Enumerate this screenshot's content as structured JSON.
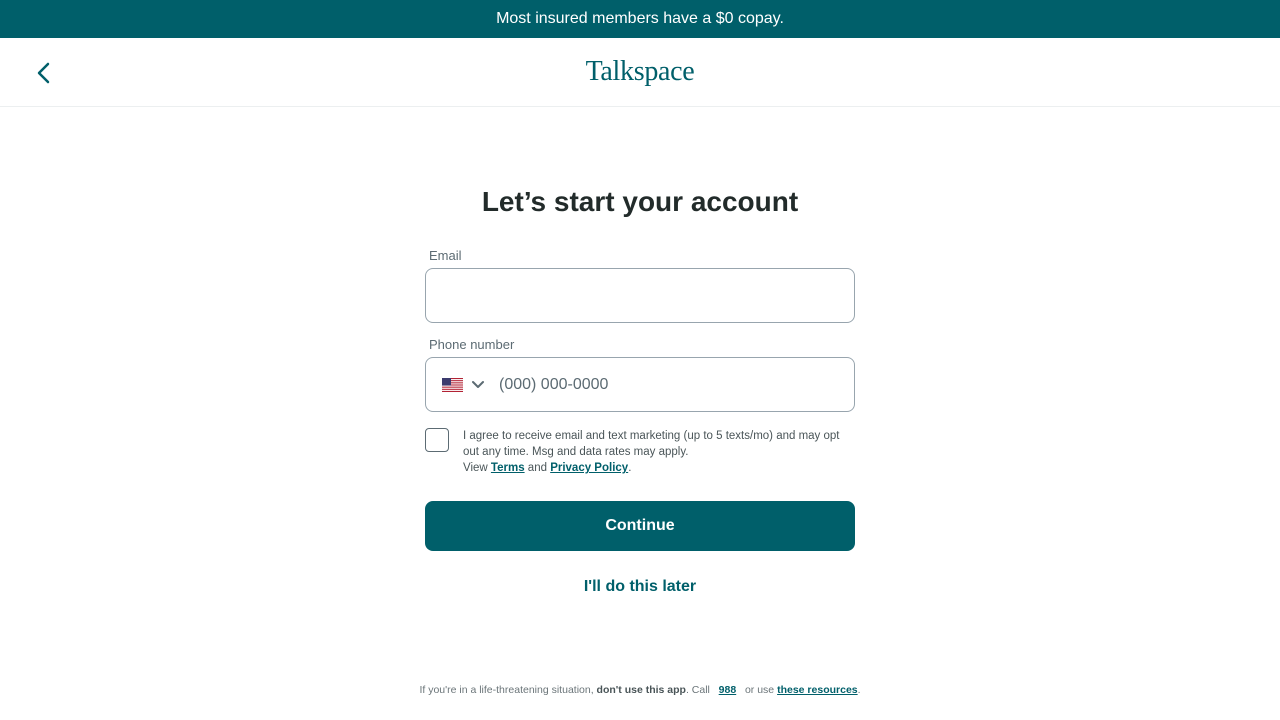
{
  "banner": {
    "text": "Most insured members have a $0 copay."
  },
  "header": {
    "logo_text": "Talkspace",
    "back_icon": "chevron-left-icon"
  },
  "form": {
    "title": "Let’s start your account",
    "email": {
      "label": "Email",
      "value": "",
      "placeholder": ""
    },
    "phone": {
      "label": "Phone number",
      "placeholder": "(000) 000-0000",
      "country_icon": "us-flag-icon",
      "dropdown_icon": "chevron-down-icon"
    },
    "consent": {
      "checked": false,
      "text": "I agree to receive email and text marketing (up to 5 texts/mo) and may opt out any time. Msg and data rates may apply.",
      "view_prefix": "View",
      "terms_link": "Terms",
      "and_text": "and",
      "privacy_link": "Privacy Policy",
      "period": "."
    },
    "continue_label": "Continue",
    "later_label": "I'll do this later"
  },
  "footer": {
    "prefix": "If you're in a life-threatening situation, ",
    "strong": "don't use this app",
    "call_text": ". Call",
    "number_link": "988",
    "or_text": "or use",
    "resources_link": "these resources",
    "period": "."
  },
  "colors": {
    "brand": "#005f6a",
    "text": "#222b2a",
    "muted": "#5c6b73",
    "border": "#98a5ae"
  }
}
